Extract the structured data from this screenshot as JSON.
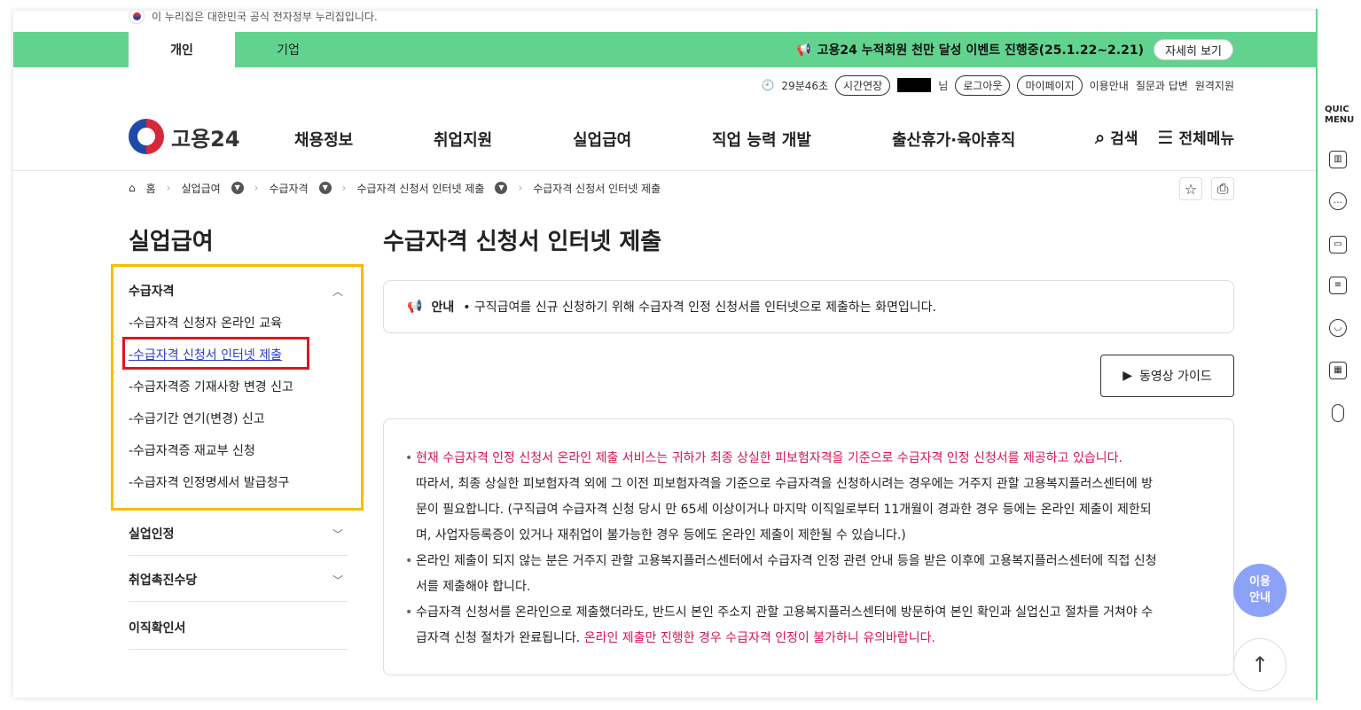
{
  "gov_banner": "이 누리집은 대한민국 공식 전자정부 누리집입니다.",
  "user_tabs": [
    "개인",
    "기업"
  ],
  "event": {
    "text": "고용24 누적회원 천만 달성 이벤트 진행중(25.1.22~2.21)",
    "button": "자세히 보기"
  },
  "util": {
    "timer": "29분46초",
    "extend": "시간연장",
    "suffix": "님",
    "logout": "로그아웃",
    "mypage": "마이페이지",
    "guide": "이용안내",
    "faq": "질문과 답변",
    "remote": "원격지원"
  },
  "logo_text": "고용24",
  "gnb": [
    "채용정보",
    "취업지원",
    "실업급여",
    "직업 능력 개발",
    "출산휴가·육아휴직"
  ],
  "gnb_right": {
    "search": "검색",
    "allmenu": "전체메뉴"
  },
  "breadcrumb": [
    "홈",
    "실업급여",
    "수급자격",
    "수급자격 신청서 인터넷 제출",
    "수급자격 신청서 인터넷 제출"
  ],
  "sidebar": {
    "title": "실업급여",
    "groups": [
      "수급자격",
      "실업인정",
      "취업촉진수당",
      "이직확인서"
    ],
    "items": [
      "-수급자격 신청자 온라인 교육",
      "-수급자격 신청서 인터넷 제출",
      "-수급자격증 기재사항 변경 신고",
      "-수급기간 연기(변경) 신고",
      "-수급자격증 재교부 신청",
      "-수급자격 인정명세서 발급청구"
    ]
  },
  "main": {
    "title": "수급자격 신청서 인터넷 제출",
    "notice_label": "안내",
    "notice_text": "• 구직급여를 신규 신청하기 위해 수급자격 인정 신청서를 인터넷으로 제출하는 화면입니다.",
    "video_btn": "동영상 가이드",
    "p1_red": "현재 수급자격 인정 신청서 온라인 제출 서비스는 귀하가 최종 상실한 피보험자격을 기준으로 수급자격 인정 신청서를 제공하고 있습니다.",
    "p1_line1": "따라서, 최종 상실한 피보험자격 외에 그 이전 피보험자격을 기준으로 수급자격을 신청하시려는 경우에는 거주지 관할 고용복지플러스센터에 방",
    "p1_line2": "문이 필요합니다. (구직급여 수급자격 신청 당시 만 65세 이상이거나 마지막 이직일로부터 11개월이 경과한 경우 등에는 온라인 제출이 제한되",
    "p1_line3": "며, 사업자등록증이 있거나 재취업이 불가능한 경우 등에도 온라인 제출이 제한될 수 있습니다.)",
    "p2_line1": "온라인 제출이 되지 않는 분은 거주지 관할 고용복지플러스센터에서 수급자격 인정 관련 안내 등을 받은 이후에 고용복지플러스센터에 직접 신청",
    "p2_line2": "서를 제출해야 합니다.",
    "p3_line1": "수급자격 신청서를 온라인으로 제출했더라도, 반드시 본인 주소지 관할 고용복지플러스센터에 방문하여 본인 확인과 실업신고 절차를 거쳐야 수",
    "p3_line2a": "급자격 신청 절차가 완료됩니다.",
    "p3_line2b": "온라인 제출만 진행한 경우 수급자격 인정이 불가하니 유의바랍니다."
  },
  "quick": {
    "title1": "QUIC",
    "title2": "MENU"
  },
  "usage_btn": [
    "이용",
    "안내"
  ],
  "colors": {
    "green": "#62d38f",
    "red": "#d4145a",
    "link": "#2b3cc9",
    "usage": "#8ca2f8"
  }
}
